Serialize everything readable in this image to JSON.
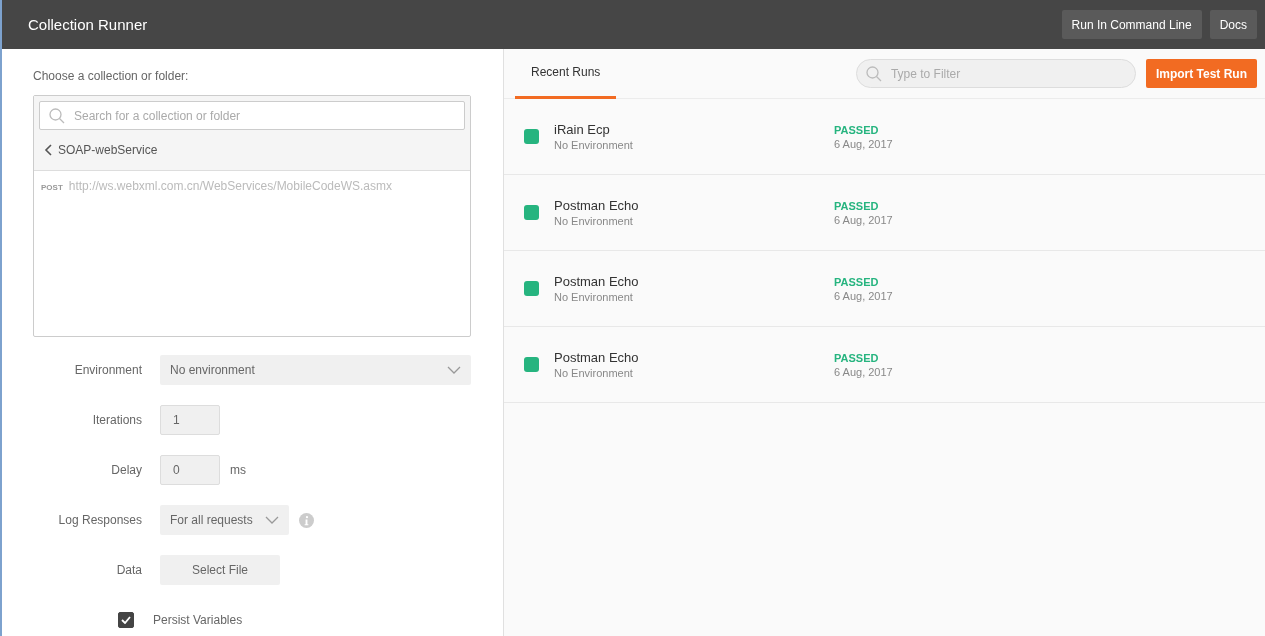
{
  "header": {
    "title": "Collection Runner",
    "buttons": [
      "Run In Command Line",
      "Docs"
    ]
  },
  "chooser": {
    "label": "Choose a collection or folder:",
    "search": {
      "placeholder": "Search for a collection or folder"
    },
    "folder": "SOAP-webService",
    "requests": [
      {
        "method": "POST",
        "url": "http://ws.webxml.com.cn/WebServices/MobileCodeWS.asmx"
      }
    ]
  },
  "fields": [
    {
      "kind": "select",
      "label": "Environment",
      "value": "No environment",
      "wide": true
    },
    {
      "kind": "number",
      "label": "Iterations",
      "value": "1"
    },
    {
      "kind": "number",
      "label": "Delay",
      "value": "0",
      "unit": "ms"
    },
    {
      "kind": "select",
      "label": "Log Responses",
      "value": "For all requests",
      "wide": false,
      "info": true
    },
    {
      "kind": "file",
      "label": "Data",
      "value": "Select File"
    }
  ],
  "persist": {
    "label": "Persist Variables",
    "checked": true
  },
  "tabs": [
    {
      "label": "Recent Runs",
      "selected": true
    }
  ],
  "filter": {
    "placeholder": "Type to Filter"
  },
  "import_button": "Import Test Run",
  "runs": [
    {
      "name": "iRain Ecp",
      "environment": "No Environment",
      "status": "PASSED",
      "date": "6 Aug, 2017",
      "color": "#26b47f"
    },
    {
      "name": "Postman Echo",
      "environment": "No Environment",
      "status": "PASSED",
      "date": "6 Aug, 2017",
      "color": "#26b47f"
    },
    {
      "name": "Postman Echo",
      "environment": "No Environment",
      "status": "PASSED",
      "date": "6 Aug, 2017",
      "color": "#26b47f"
    },
    {
      "name": "Postman Echo",
      "environment": "No Environment",
      "status": "PASSED",
      "date": "6 Aug, 2017",
      "color": "#26b47f"
    }
  ]
}
